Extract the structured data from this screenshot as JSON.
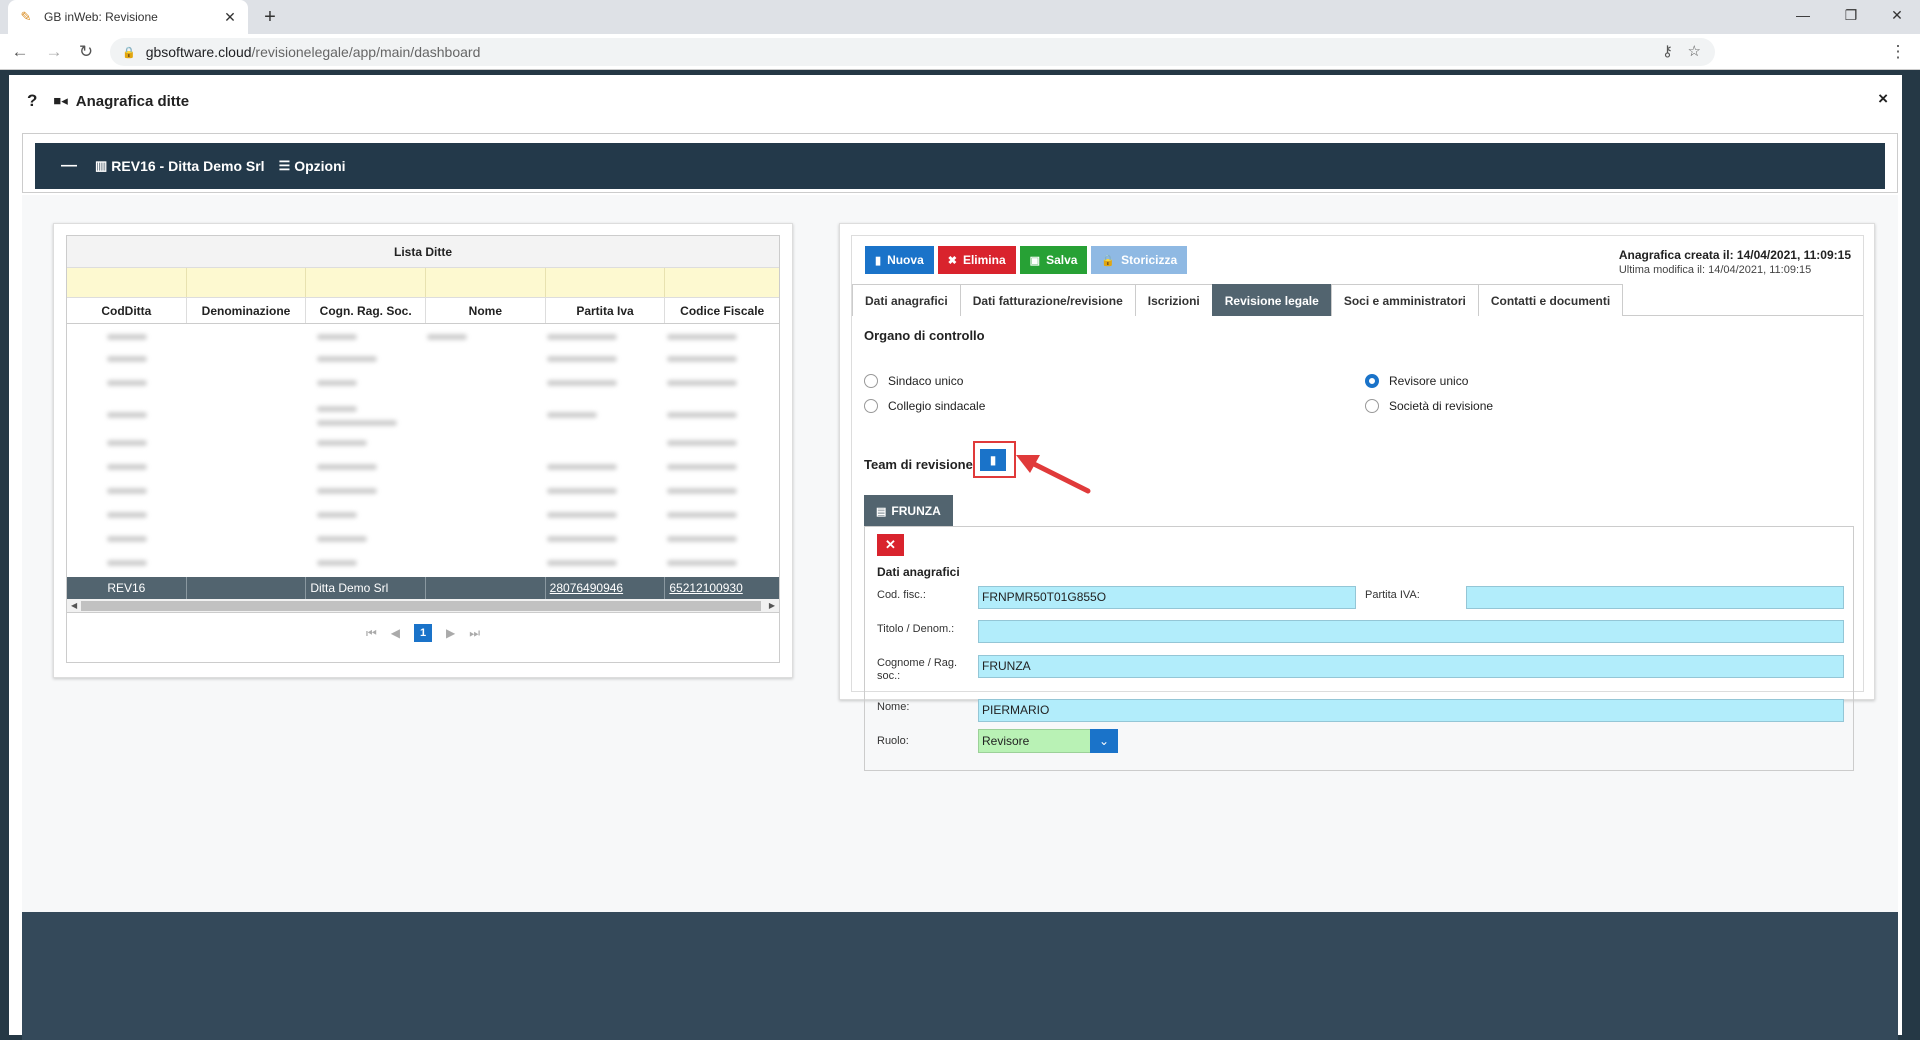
{
  "browser": {
    "tab_title": "GB inWeb: Revisione",
    "url_host": "gbsoftware.cloud",
    "url_path": "/revisionelegale/app/main/dashboard"
  },
  "modal": {
    "title": "Anagrafica ditte",
    "help": "?",
    "close": "×"
  },
  "topbar": {
    "company": "REV16 - Ditta Demo Srl",
    "options": "Opzioni"
  },
  "list": {
    "title": "Lista Ditte",
    "columns": [
      "CodDitta",
      "Denominazione",
      "Cogn. Rag. Soc.",
      "Nome",
      "Partita Iva",
      "Codice Fiscale"
    ],
    "selected_row": [
      "REV16",
      "",
      "Ditta Demo Srl",
      "",
      "28076490946",
      "65212100930"
    ],
    "current_page": "1"
  },
  "form": {
    "buttons": {
      "new": "Nuova",
      "delete": "Elimina",
      "save": "Salva",
      "history": "Storicizza"
    },
    "created": "Anagrafica creata il: 14/04/2021, 11:09:15",
    "modified": "Ultima modifica il: 14/04/2021, 11:09:15",
    "tabs": [
      "Dati anagrafici",
      "Dati fatturazione/revisione",
      "Iscrizioni",
      "Revisione legale",
      "Soci e amministratori",
      "Contatti e documenti"
    ],
    "active_tab": "Revisione legale",
    "organ_title": "Organo di controllo",
    "radios": {
      "sindaco": "Sindaco unico",
      "collegio": "Collegio sindacale",
      "revisore": "Revisore unico",
      "societa": "Società di revisione"
    },
    "selected_radio": "Revisore unico",
    "team_title": "Team di revisione",
    "member": {
      "tab": "FRUNZA",
      "section": "Dati anagrafici",
      "cod_fisc_label": "Cod. fisc.:",
      "cod_fisc": "FRNPMR50T01G855O",
      "piva_label": "Partita IVA:",
      "piva": "",
      "titolo_label": "Titolo / Denom.:",
      "titolo": "",
      "cognome_label": "Cognome / Rag. soc.:",
      "cognome": "FRUNZA",
      "nome_label": "Nome:",
      "nome": "PIERMARIO",
      "ruolo_label": "Ruolo:",
      "ruolo": "Revisore"
    }
  },
  "colors": {
    "primary": "#1a73c9",
    "danger": "#d9232d",
    "success": "#27a135",
    "dark": "#23394a",
    "tab_active": "#52646f",
    "input_bg": "#b2edfb"
  }
}
